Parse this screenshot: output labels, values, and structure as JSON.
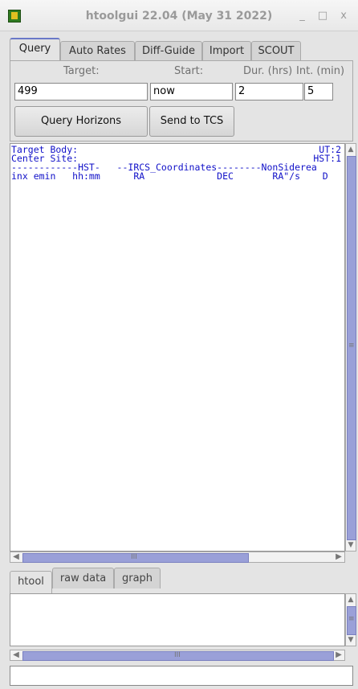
{
  "window": {
    "title": "htoolgui 22.04 (May 31 2022)",
    "controls": [
      "_",
      "□",
      "x"
    ]
  },
  "tabs": [
    {
      "label": "Query",
      "active": true
    },
    {
      "label": "Auto Rates",
      "active": false
    },
    {
      "label": "Diff-Guide",
      "active": false
    },
    {
      "label": "Import",
      "active": false
    },
    {
      "label": "SCOUT",
      "active": false
    }
  ],
  "query": {
    "target_label": "Target:",
    "start_label": "Start:",
    "dur_label": "Dur. (hrs)",
    "int_label": "Int. (min)",
    "target_value": "499",
    "start_value": "now",
    "dur_value": "2",
    "int_value": "5",
    "query_button": "Query Horizons",
    "send_button": "Send to TCS"
  },
  "output": {
    "lines_left": [
      "Target Body:",
      "Center Site:",
      "------------HST-   --IRCS_Coordinates--------NonSiderea",
      "inx emin   hh:mm      RA             DEC       RA\"/s    D"
    ],
    "lines_right": [
      "UT:2",
      "HST:1"
    ]
  },
  "bottom_tabs": [
    {
      "label": "htool",
      "active": true
    },
    {
      "label": "raw data",
      "active": false
    },
    {
      "label": "graph",
      "active": false
    }
  ],
  "scroll": {
    "grip": "III",
    "vgrip": "≡"
  },
  "colors": {
    "accent": "#6a78c8",
    "output_text": "#1010c8",
    "scroll_thumb": "#9aa0d8"
  }
}
